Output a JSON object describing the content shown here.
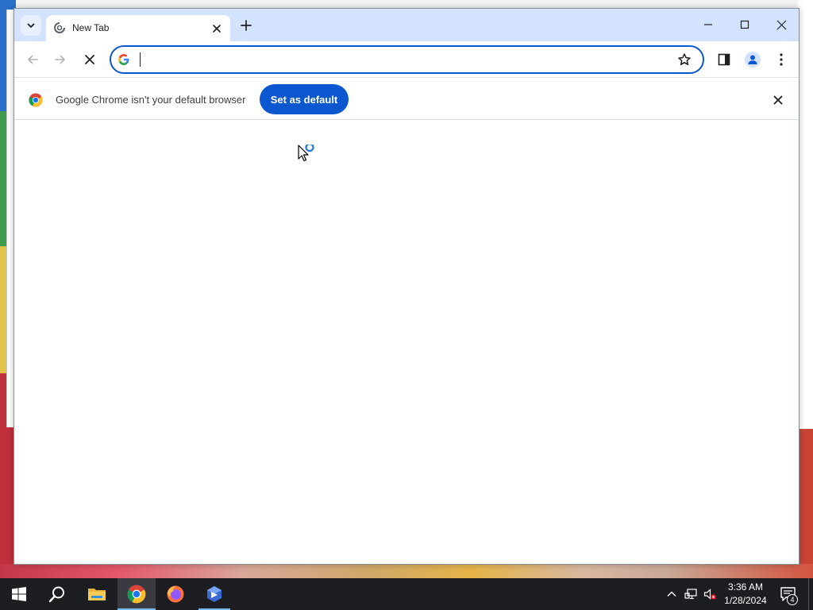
{
  "browser": {
    "tab": {
      "title": "New Tab"
    },
    "omnibox": {
      "value": "",
      "placeholder": ""
    },
    "infobar": {
      "message": "Google Chrome isn't your default browser",
      "button_label": "Set as default"
    },
    "colors": {
      "accent": "#0b57d0",
      "tabstrip": "#d3e3fd"
    }
  },
  "taskbar": {
    "pinned_apps": [
      "start-icon",
      "search-icon",
      "file-explorer-icon",
      "chrome-icon",
      "firefox-icon",
      "app-icon"
    ],
    "clock": {
      "time": "3:36 AM",
      "date": "1/28/2024"
    },
    "notification_count": "4"
  }
}
